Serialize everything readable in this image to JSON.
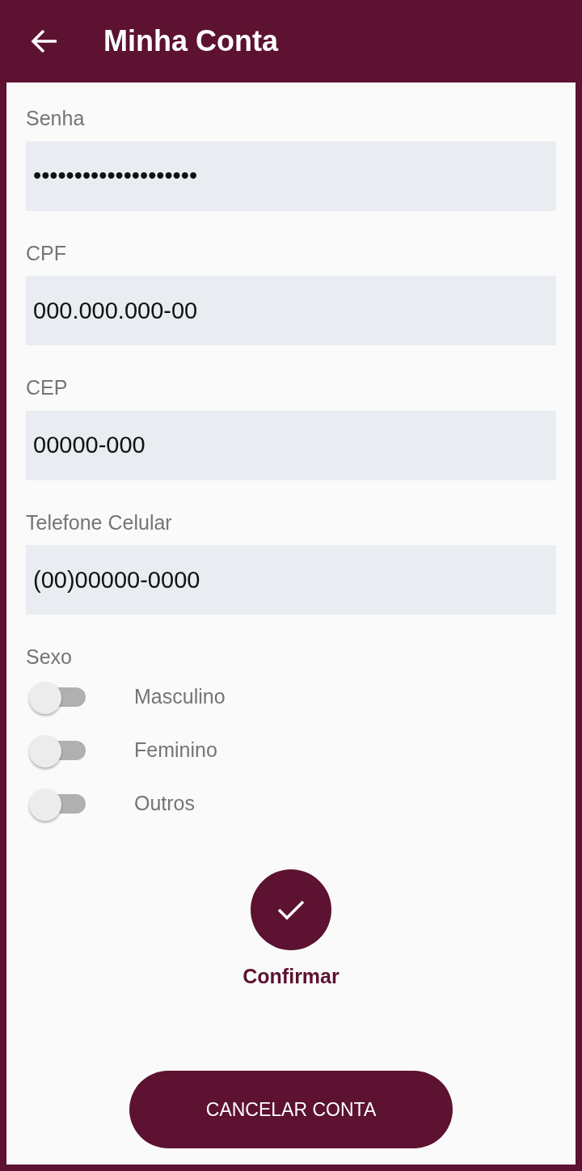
{
  "header": {
    "title": "Minha Conta"
  },
  "fields": [
    {
      "label": "Senha",
      "value": "••••••••••••••••••••"
    },
    {
      "label": "CPF",
      "value": "000.000.000-00"
    },
    {
      "label": "CEP",
      "value": "00000-000"
    },
    {
      "label": "Telefone Celular",
      "value": "(00)00000-0000"
    }
  ],
  "sexo": {
    "label": "Sexo",
    "options": [
      {
        "label": "Masculino",
        "on": false
      },
      {
        "label": "Feminino",
        "on": false
      },
      {
        "label": "Outros",
        "on": false
      }
    ]
  },
  "confirm": {
    "label": "Confirmar"
  },
  "cancel_button": "CANCELAR CONTA"
}
